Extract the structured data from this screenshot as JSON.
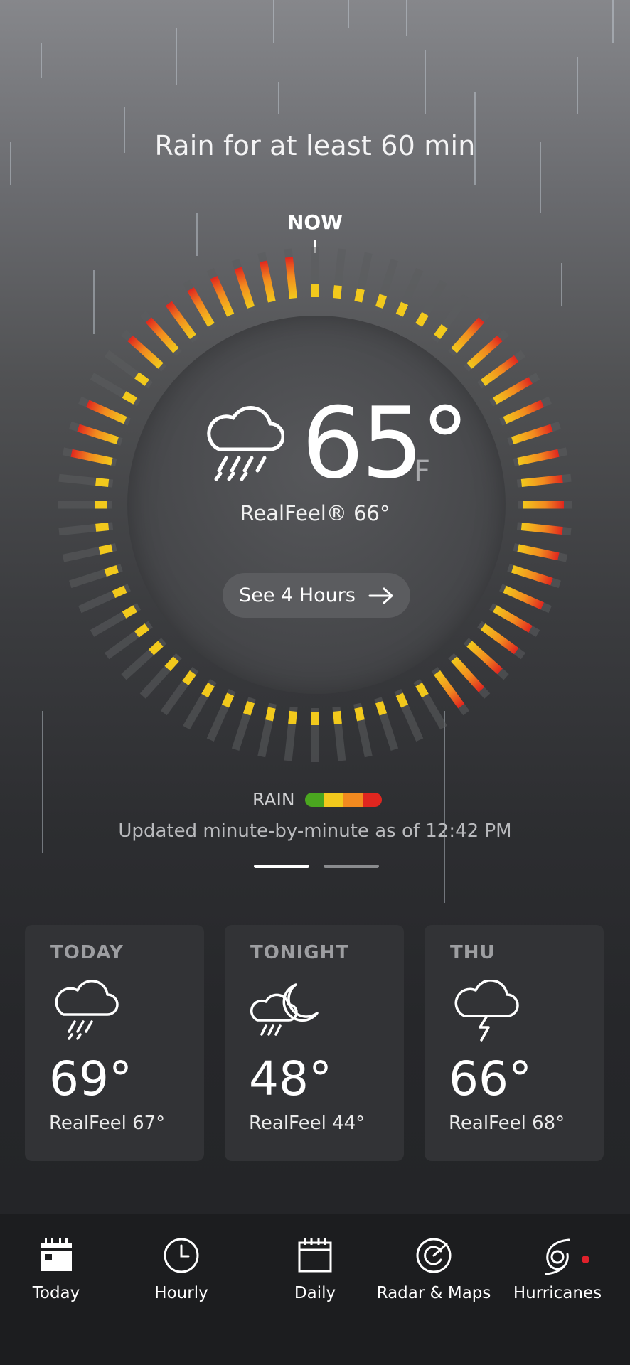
{
  "headline": "Rain for at least 60 min",
  "now_label": "NOW",
  "current": {
    "icon": "rain-cloud-icon",
    "temperature": "65°",
    "unit": "F",
    "realfeel": "RealFeel® 66°"
  },
  "see_hours_button": {
    "label": "See 4 Hours",
    "icon": "arrow-right-icon"
  },
  "precip_dial": {
    "minutes": 60,
    "segment_intensity": [
      2,
      2,
      2,
      2,
      2,
      2,
      2,
      3,
      3,
      3,
      3,
      3,
      3,
      3,
      3,
      3,
      3,
      3,
      3,
      3,
      3,
      3,
      3,
      3,
      3,
      2,
      2,
      2,
      2,
      2,
      2,
      2,
      2,
      2,
      2,
      2,
      2,
      2,
      2,
      2,
      2,
      2,
      2,
      2,
      2,
      2,
      2,
      3,
      3,
      3,
      2,
      2,
      3,
      3,
      3,
      3,
      3,
      3,
      3,
      3
    ]
  },
  "legend": {
    "label": "RAIN",
    "colors": [
      "#4aa61f",
      "#f2c91c",
      "#f28a1f",
      "#e0261f"
    ]
  },
  "updated_text": "Updated minute-by-minute as of 12:42 PM",
  "pager": {
    "pages": 2,
    "active": 0
  },
  "forecast_cards": [
    {
      "name": "TODAY",
      "icon": "rain-cloud-icon",
      "temp": "69°",
      "realfeel": "RealFeel 67°"
    },
    {
      "name": "TONIGHT",
      "icon": "moon-cloud-rain-icon",
      "temp": "48°",
      "realfeel": "RealFeel 44°"
    },
    {
      "name": "THU",
      "icon": "thunderstorm-icon",
      "temp": "66°",
      "realfeel": "RealFeel 68°"
    }
  ],
  "tabs": [
    {
      "label": "Today",
      "icon": "calendar-today-icon",
      "active": true
    },
    {
      "label": "Hourly",
      "icon": "clock-icon"
    },
    {
      "label": "Daily",
      "icon": "calendar-icon"
    },
    {
      "label": "Radar & Maps",
      "icon": "radar-icon"
    },
    {
      "label": "Hurricanes",
      "icon": "hurricane-icon",
      "badge": true
    }
  ],
  "colors": {
    "track": "#5b5c5f",
    "none_segment": "#6a6b6e"
  }
}
